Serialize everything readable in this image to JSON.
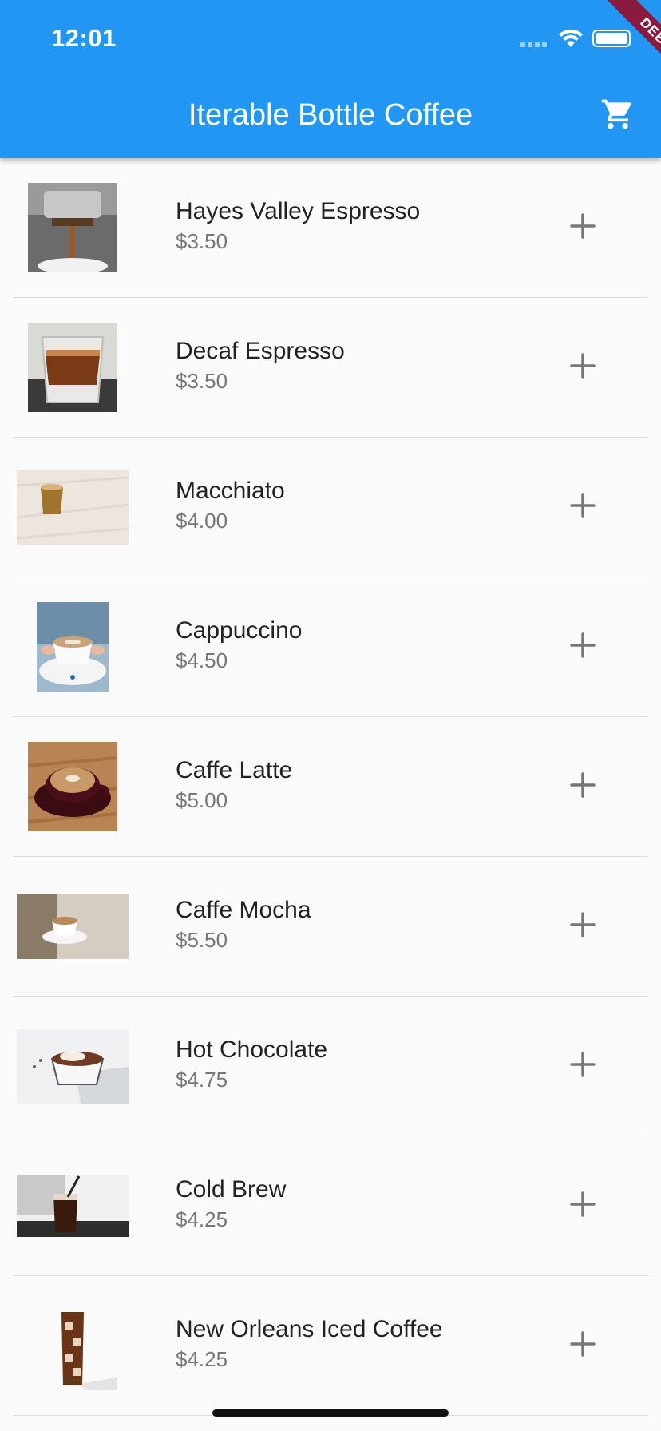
{
  "status_bar": {
    "time": "12:01"
  },
  "app_bar": {
    "title": "Iterable Bottle Coffee",
    "cart_icon": "cart-icon"
  },
  "debug_banner": "DEBUG",
  "products": [
    {
      "name": "Hayes Valley Espresso",
      "price": "$3.50"
    },
    {
      "name": "Decaf Espresso",
      "price": "$3.50"
    },
    {
      "name": "Macchiato",
      "price": "$4.00"
    },
    {
      "name": "Cappuccino",
      "price": "$4.50"
    },
    {
      "name": "Caffe Latte",
      "price": "$5.00"
    },
    {
      "name": "Caffe Mocha",
      "price": "$5.50"
    },
    {
      "name": "Hot Chocolate",
      "price": "$4.75"
    },
    {
      "name": "Cold Brew",
      "price": "$4.25"
    },
    {
      "name": "New Orleans Iced Coffee",
      "price": "$4.25"
    }
  ],
  "colors": {
    "app_bar": "#2196f3",
    "background": "#fafafa",
    "debug": "#8b1a3f"
  }
}
